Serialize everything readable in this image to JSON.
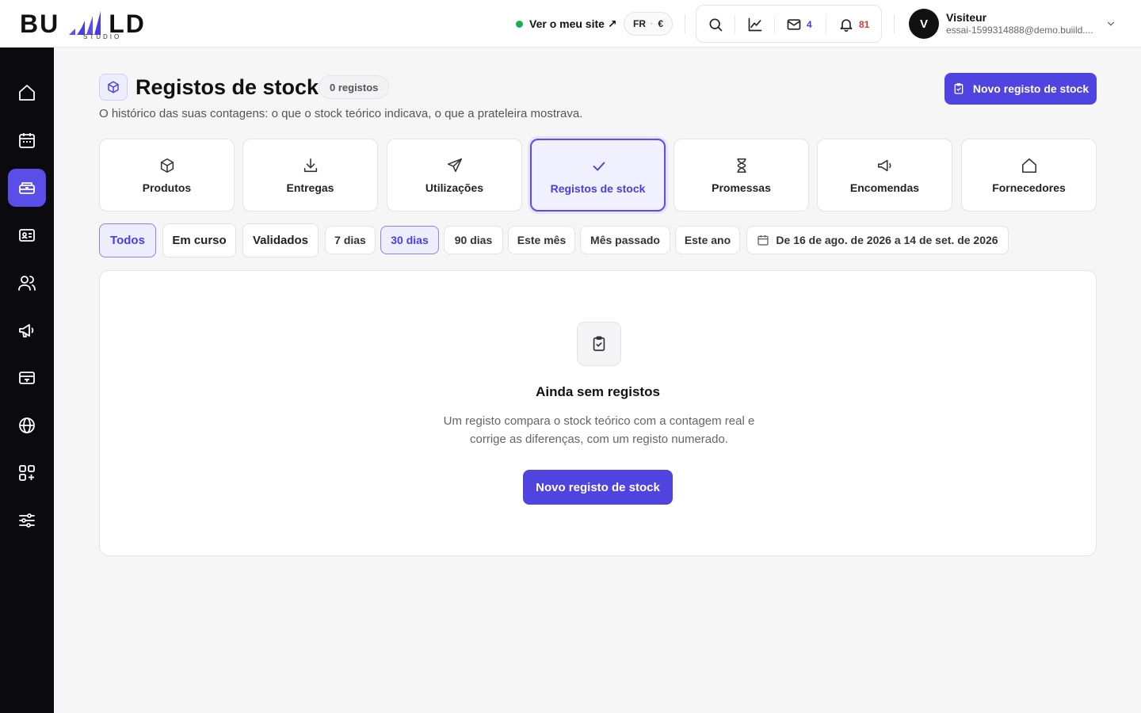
{
  "header": {
    "logo_text_left": "BU",
    "logo_text_right": "LD",
    "logo_sub": "STUDIO",
    "site_link": "Ver o meu site ↗",
    "lang": "FR",
    "currency": "€",
    "mail_count": "4",
    "bell_count": "81",
    "user_initial": "V",
    "user_name": "Visiteur",
    "user_email": "essai-1599314888@demo.buiild...."
  },
  "sidebar": {
    "icons": [
      "home-icon",
      "calendar-icon",
      "inventory-icon",
      "contact-card-icon",
      "users-icon",
      "megaphone-icon",
      "payment-card-icon",
      "globe-icon",
      "apps-icon",
      "sliders-icon"
    ],
    "active_index": 2
  },
  "page": {
    "title": "Registos de stock",
    "count_badge": "0 registos",
    "subtitle": "O histórico das suas contagens: o que o stock teórico indicava, o que a prateleira mostrava.",
    "new_button": "Novo registo de stock"
  },
  "tabs": [
    {
      "label": "Produtos",
      "icon": "box-icon"
    },
    {
      "label": "Entregas",
      "icon": "download-icon"
    },
    {
      "label": "Utilizações",
      "icon": "send-icon"
    },
    {
      "label": "Registos de stock",
      "icon": "check-icon",
      "active": true
    },
    {
      "label": "Promessas",
      "icon": "hourglass-icon"
    },
    {
      "label": "Encomendas",
      "icon": "megaphone-icon"
    },
    {
      "label": "Fornecedores",
      "icon": "house-icon"
    }
  ],
  "status_filters": [
    {
      "label": "Todos",
      "active": true
    },
    {
      "label": "Em curso"
    },
    {
      "label": "Validados"
    }
  ],
  "period_filters": [
    {
      "label": "7 dias"
    },
    {
      "label": "30 dias",
      "active": true
    },
    {
      "label": "90 dias"
    },
    {
      "label": "Este mês"
    },
    {
      "label": "Mês passado"
    },
    {
      "label": "Este ano"
    }
  ],
  "date_range": "De 16 de ago. de 2026 a 14 de set. de 2026",
  "empty_state": {
    "title": "Ainda sem registos",
    "text": "Um registo compara o stock teórico com a contagem real e corrige as diferenças, com um registo numerado.",
    "button": "Novo registo de stock"
  },
  "colors": {
    "accent": "#4f44e0",
    "sidebar_bg": "#0b0b0f",
    "status_online": "#16b34a",
    "bell_count": "#d63a3a"
  }
}
